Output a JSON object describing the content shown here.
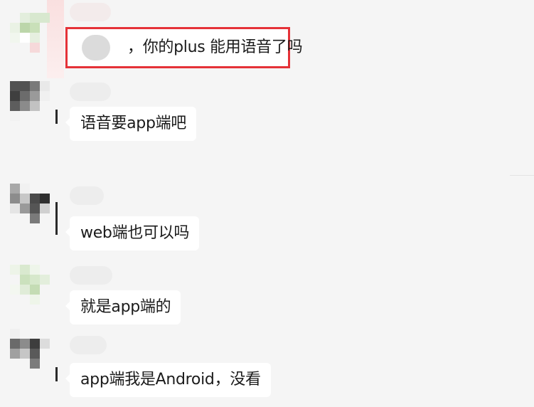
{
  "messages": [
    {
      "id": "m1",
      "text": "，你的plus 能用语音了吗",
      "highlighted": true
    },
    {
      "id": "m2",
      "text": "语音要app端吧"
    },
    {
      "id": "m3",
      "text": "web端也可以吗"
    },
    {
      "id": "m4",
      "text": "就是app端的"
    },
    {
      "id": "m5",
      "text": "app端我是Android，没看"
    }
  ],
  "colors": {
    "background": "#f5f5f5",
    "bubble": "#ffffff",
    "highlight_border": "#e53238",
    "text": "#1b1b1b"
  }
}
